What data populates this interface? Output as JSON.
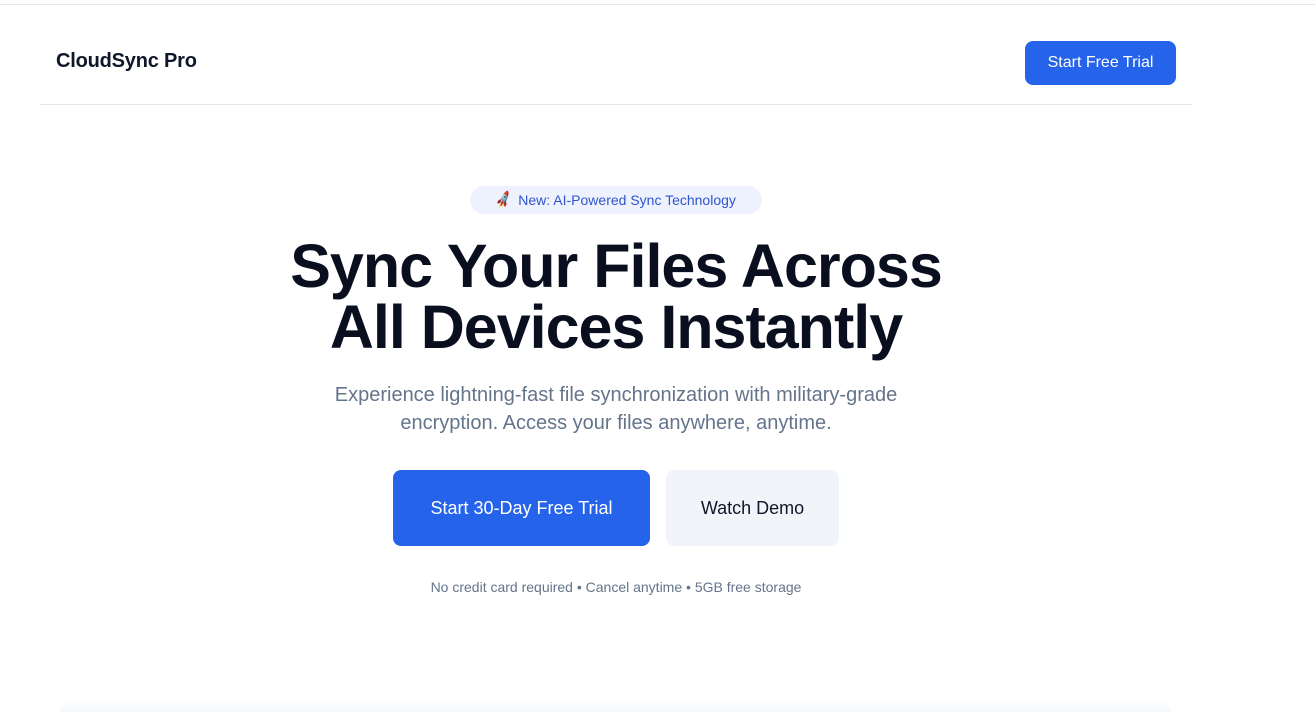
{
  "header": {
    "brand": "CloudSync Pro",
    "cta_label": "Start Free Trial"
  },
  "hero": {
    "badge_icon": "rocket-icon",
    "badge_text": "New: AI-Powered Sync Technology",
    "headline_line1": "Sync Your Files Across",
    "headline_line2": "All Devices Instantly",
    "subheadline": "Experience lightning-fast file synchronization with military-grade encryption. Access your files anywhere, anytime.",
    "primary_cta": "Start 30-Day Free Trial",
    "secondary_cta": "Watch Demo",
    "fineprint": "No credit card required • Cancel anytime • 5GB free storage"
  },
  "colors": {
    "accent": "#2563eb",
    "badge_bg": "#eef2ff",
    "badge_text": "#2f55c9",
    "secondary_bg": "#f1f5f9",
    "muted_text": "#64748b"
  }
}
